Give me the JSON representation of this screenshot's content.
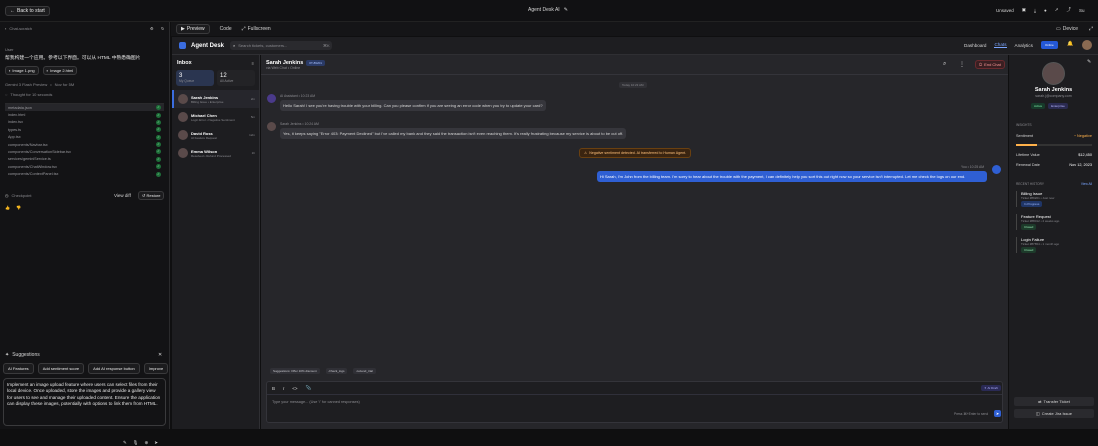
{
  "topbar": {
    "back_label": "Back to start",
    "title": "Agent Desk AI",
    "unsaved": "Unsaved",
    "user_initials": "Su"
  },
  "left": {
    "collapse_label": "Chat-scratch",
    "user_label": "User",
    "prompt": "帮我构建一个应用。参考以下界面。可以从 HTML 中熟悉确图片",
    "attachments": [
      "Image 1.png",
      "Image 2.html"
    ],
    "model_label": "Gemini 3 Flash Preview",
    "time_label": "Nov for 5M",
    "thought_label": "Thought for 10 seconds",
    "files": [
      "metadata.json",
      "index.html",
      "index.tsx",
      "types.ts",
      "App.tsx",
      "components/Navbar.tsx",
      "components/ConversationSidebar.tsx",
      "services/geminiService.ts",
      "components/ChatWindow.tsx",
      "components/ContextPanel.tsx"
    ],
    "checkpoint_label": "Checkpoint",
    "view_diff": "View diff",
    "restore": "Restore",
    "suggestions_label": "Suggestions",
    "chips": [
      "AI Features",
      "Add sentiment score",
      "Add AI response button",
      "Improve"
    ],
    "input_text": "Implement an image upload feature where users can select files from their local device. Once uploaded, store the images and provide a gallery view for users to see and manage their uploaded content. Ensure the application can display these images, potentially with options to link them from HTML."
  },
  "preview_bar": {
    "tabs": [
      "Preview",
      "Code",
      "Fullscreen"
    ],
    "device": "Device"
  },
  "app": {
    "brand": "Agent Desk",
    "search_placeholder": "Search tickets, customers...",
    "search_kbd": "⌘K",
    "nav": [
      "Dashboard",
      "Chats",
      "Analytics"
    ],
    "status": "Online",
    "inbox": {
      "title": "Inbox",
      "stats": [
        {
          "n": "3",
          "label": "My Queue"
        },
        {
          "n": "12",
          "label": "All Active"
        }
      ],
      "items": [
        {
          "name": "Sarah Jenkins",
          "sub": "Billing Issue • Enterprise",
          "time": "2m"
        },
        {
          "name": "Michael Chen",
          "sub": "Login Error • Negative Sentiment",
          "time": "5m"
        },
        {
          "name": "David Ross",
          "sub": "AI Feature Request",
          "time": "12m"
        },
        {
          "name": "Emma Wilson",
          "sub": "Resolved • Refund Processed",
          "time": "1h"
        }
      ]
    },
    "chat": {
      "name": "Sarah Jenkins",
      "ticket": "#T-89201",
      "via": "via Web Chat • Online",
      "end": "End Chat",
      "day": "Today 10:23 AM",
      "messages": [
        {
          "who": "AI Assistant • 10:23 AM",
          "text": "Hello Sarah! I see you're having trouble with your billing. Can you please confirm if you are seeing an error code when you try to update your card?"
        },
        {
          "who": "Sarah Jenkins • 10:24 AM",
          "text": "Yes, it keeps saying \"Error 403: Payment Declined\" but I've called my bank and they said the transaction isn't even reaching them. It's really frustrating because my service is about to be cut off."
        }
      ],
      "alert": "Negative sentiment detected. AI transferred to Human Agent.",
      "reply_meta": "You • 10:25 AM",
      "reply": "Hi Sarah, I'm John from the billing team. I'm sorry to hear about the trouble with the payment, I can definitely help you sort this out right now so your service isn't interrupted. Let me check the logs on our end.",
      "suggestions": [
        "Suggestions: Offer 10% discount",
        "/check_logs",
        "/extend_trial"
      ],
      "compose_placeholder": "Type your message... (Use '/' for canned responses)",
      "ai_draft": "AI Draft",
      "send_hint": "Press ⌘+Enter to send"
    },
    "profile": {
      "name": "Sarah Jenkins",
      "email": "sarah.j@company.com",
      "badges": [
        "Active",
        "Enterprise"
      ],
      "insights": "INSIGHTS",
      "sentiment_label": "Sentiment",
      "sentiment": "Negative",
      "ltv_label": "Lifetime Value",
      "ltv": "$12,450",
      "renewal_label": "Renewal Date",
      "renewal": "Nov 12, 2023",
      "history_label": "RECENT HISTORY",
      "view_all": "View All",
      "history": [
        {
          "title": "Billing Issue",
          "sub": "Ticket #89201 • Just now",
          "status": "In Progress"
        },
        {
          "title": "Feature Request",
          "sub": "Ticket #88012 • 2 weeks ago",
          "status": "Closed"
        },
        {
          "title": "Login Failure",
          "sub": "Ticket #87654 • 1 month ago",
          "status": "Closed"
        }
      ],
      "transfer": "Transfer Ticket",
      "jira": "Create Jira Issue"
    }
  }
}
